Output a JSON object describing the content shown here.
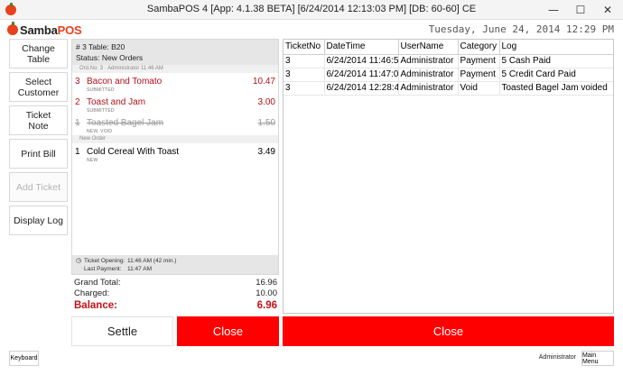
{
  "window": {
    "title": "SambaPOS 4 [App: 4.1.38 BETA] [6/24/2014 12:13:03 PM] [DB: 60-60] CE",
    "minimize_glyph": "—",
    "maximize_glyph": "☐",
    "close_glyph": "✕"
  },
  "brand": {
    "prefix": "Samba",
    "suffix": "POS"
  },
  "header": {
    "date": "Tuesday, June 24, 2014 12:29 PM"
  },
  "left_buttons": {
    "change_table": "Change\nTable",
    "select_customer": "Select\nCustomer",
    "ticket_note": "Ticket\nNote",
    "print_bill": "Print Bill",
    "add_ticket": "Add Ticket",
    "display_log": "Display Log"
  },
  "ticket": {
    "header_line": "# 3 Table: B20",
    "status": "Status: New Orders",
    "group_label": "Ord.No: 3 · Administrator 11:46 AM",
    "orders": [
      {
        "qty": "3",
        "name": "Bacon and Tomato",
        "price": "10.47",
        "tag": "SUBMITTED"
      },
      {
        "qty": "2",
        "name": "Toast and Jam",
        "price": "3.00",
        "tag": "SUBMITTED"
      },
      {
        "qty": "1",
        "name": "Toasted Bagel Jam",
        "price": "1.50",
        "tag": "NEW, VOID"
      }
    ],
    "new_order_label": "New Order",
    "new_orders": [
      {
        "qty": "1",
        "name": "Cold Cereal With Toast",
        "price": "3.49",
        "tag": "NEW"
      }
    ],
    "footer": {
      "opening_label": "Ticket Opening:",
      "opening_value": "11:46 AM (42 min.)",
      "payment_label": "Last Payment:",
      "payment_value": "11:47 AM"
    }
  },
  "totals": {
    "grand_total_label": "Grand Total:",
    "grand_total_value": "16.96",
    "charged_label": "Charged:",
    "charged_value": "10.00",
    "balance_label": "Balance:",
    "balance_value": "6.96"
  },
  "actions": {
    "settle": "Settle",
    "close": "Close"
  },
  "log": {
    "columns": [
      "TicketNo",
      "DateTime",
      "UserName",
      "Category",
      "Log"
    ],
    "rows": [
      [
        "3",
        "6/24/2014 11:46:5",
        "Administrator",
        "Payment",
        "5 Cash Paid"
      ],
      [
        "3",
        "6/24/2014 11:47:0",
        "Administrator",
        "Payment",
        "5 Credit Card Paid"
      ],
      [
        "3",
        "6/24/2014 12:28:4",
        "Administrator",
        "Void",
        "Toasted Bagel Jam voided"
      ]
    ],
    "close": "Close"
  },
  "footer": {
    "keyboard": "Keyboard",
    "user": "Administrator",
    "main_menu": "Main Menu"
  },
  "colors": {
    "accent_red": "#ff0000",
    "balance_red": "#c8101a",
    "submitted_red": "#b0101a"
  },
  "icons": {
    "app": "sambapos-logo-icon",
    "clock": "clock-icon"
  }
}
